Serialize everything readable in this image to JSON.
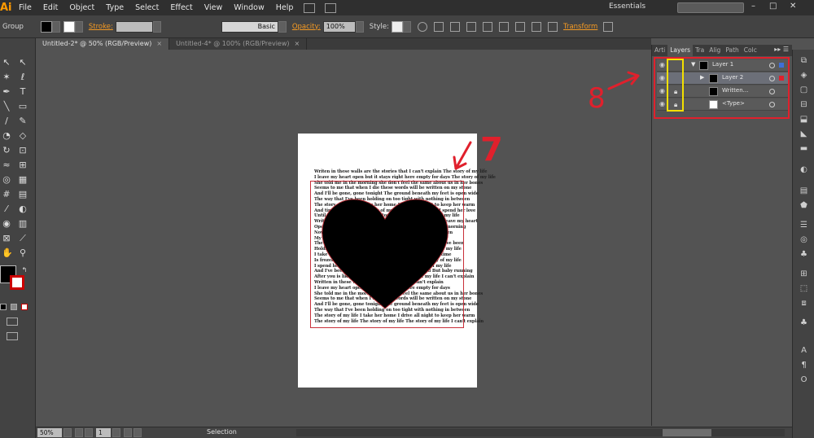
{
  "menubar": {
    "logo": "Ai",
    "items": [
      "File",
      "Edit",
      "Object",
      "Type",
      "Select",
      "Effect",
      "View",
      "Window",
      "Help"
    ],
    "workspace": "Essentials"
  },
  "controlbar": {
    "selection_type": "Group",
    "stroke_label": "Stroke:",
    "brush_value": "Basic",
    "opacity_label": "Opacity:",
    "opacity_value": "100%",
    "style_label": "Style:",
    "transform_label": "Transform"
  },
  "tabs": [
    {
      "label": "Untitled-2* @ 50% (RGB/Preview)",
      "close": "×"
    },
    {
      "label": "Untitled-4* @ 100% (RGB/Preview)",
      "close": "×"
    }
  ],
  "artboard": {
    "text_lines": [
      "Writen in these walls are the stories that I can't explain The story of my life",
      "I leave my heart open but it stays right here empty for days The story of my life",
      "She told me in the morning she don't feel the same about us in her bones",
      "Seems to me that when I die these words will be written on my stone",
      "And I'll be gone, gone tonight The ground beneath my feet is open wide",
      "The way that I've been holding on too tight with nothing in between",
      "The story of my life I take her home I drive all night to keep her warm",
      "And time is frozen The story of my life I give her hope I spend her love",
      "Until she's broke inside The story of my life The story of my life",
      "Writen on these walls are the colors that I can't change Leave my heart",
      "Open but it stays right here in its cage I know that in the morning",
      "Now I see us in the light upon the hill Although I am broken",
      "My heart is untamed still And I'll be gone, gone tonight",
      "The fire beneath my feet is burning bright The way that I've been",
      "Holding on so tight with nothing in between The story of my life",
      "I take her home I drive all night to keep her warm And time",
      "Is frozen The story of my life I give her hope The story of my life",
      "I spend her love until she's broke inside The story of my life",
      "And I've been waiting for this time to come around But baby running",
      "After you is like chasing the clouds The story of my life I can't explain",
      "Written in these walls are the stories that I can't explain",
      "I leave my heart open but it stays right here empty for days",
      "She told me in the morning she don't feel the same about us in her bones",
      "Seems to me that when I die these words will be written on my stone",
      "And I'll be gone, gone tonight The ground beneath my feet is open wide",
      "The way that I've been holding on too tight with nothing in between",
      "The story of my life I take her home I drive all night to keep her warm",
      "The story of my life The story of my life The story of my life I can't explain"
    ]
  },
  "annotations": {
    "seven": "7",
    "eight": "8"
  },
  "layers_panel": {
    "tabs": [
      "Arti",
      "Layers",
      "Tra",
      "Alig",
      "Path",
      "Colc"
    ],
    "rows": [
      {
        "name": "Layer 1",
        "locked": false,
        "color": "#3f6fd8"
      },
      {
        "name": "Layer 2",
        "locked": false,
        "color": "#e0202c"
      },
      {
        "name": "Written...",
        "locked": true,
        "color": ""
      },
      {
        "name": "<Type>",
        "locked": true,
        "color": ""
      }
    ]
  },
  "statusbar": {
    "zoom": "50%",
    "artboard_num": "1",
    "tool_name": "Selection"
  }
}
